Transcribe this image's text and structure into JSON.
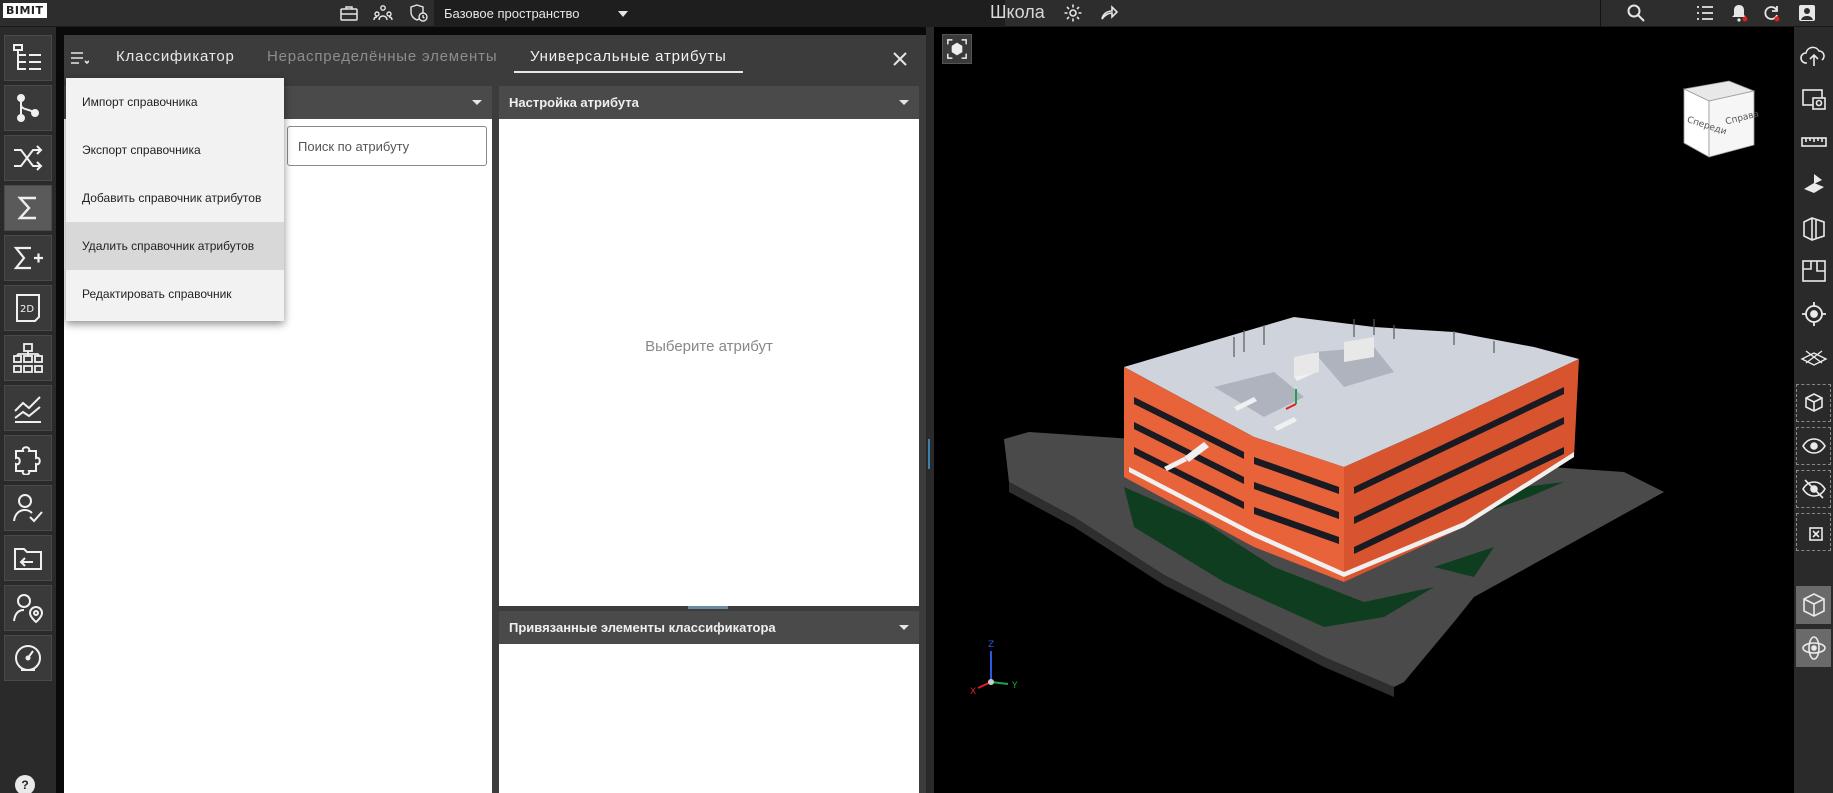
{
  "app": {
    "logo_text": "BIMIT",
    "space_label": "Базовое пространство",
    "project_title": "Школа"
  },
  "top_icons_left": [
    "briefcase-icon",
    "team-icon",
    "shield-clock-icon"
  ],
  "top_icons_center": [
    "gear-icon",
    "share-arrow-icon"
  ],
  "top_icons_right": [
    "search-icon",
    "list-icon",
    "bell-icon",
    "sync-icon",
    "user-icon"
  ],
  "left_toolbar": [
    {
      "name": "tree-structure-icon",
      "active": false
    },
    {
      "name": "branch-icon",
      "active": false
    },
    {
      "name": "shuffle-icon",
      "active": false
    },
    {
      "name": "sigma-icon",
      "active": true
    },
    {
      "name": "sigma-plus-icon",
      "active": false
    },
    {
      "name": "2d-sheet-icon",
      "active": false
    },
    {
      "name": "hierarchy-icon",
      "active": false
    },
    {
      "name": "chart-lines-icon",
      "active": false
    },
    {
      "name": "puzzle-icon",
      "active": false
    },
    {
      "name": "user-check-icon",
      "active": false
    },
    {
      "name": "folder-export-icon",
      "active": false
    },
    {
      "name": "user-location-icon",
      "active": false
    },
    {
      "name": "gauge-icon",
      "active": false
    }
  ],
  "help_label": "?",
  "panel": {
    "tabs": [
      {
        "label": "Классификатор"
      },
      {
        "label": "Нераспределённые элементы"
      },
      {
        "label": "Универсальные атрибуты"
      }
    ],
    "search_placeholder": "Поиск по атрибуту",
    "attr_settings_title": "Настройка атрибута",
    "attr_placeholder": "Выберите атрибут",
    "linked_title": "Привязанные элементы классификатора"
  },
  "dropdown": {
    "items": [
      {
        "label": "Импорт справочника"
      },
      {
        "label": "Экспорт справочника"
      },
      {
        "label": "Добавить справочник атрибутов"
      },
      {
        "label": "Удалить справочник атрибутов"
      },
      {
        "label": "Редактировать справочник"
      }
    ]
  },
  "viewcube": {
    "front": "Спереди",
    "right": "Справа"
  },
  "axes": {
    "x": "X",
    "y": "Y",
    "z": "Z"
  },
  "right_toolbar": [
    "cloud-upload-icon",
    "screenshot-icon",
    "ruler-icon",
    "section-plane-icon",
    "section-box-icon",
    "floor-plan-icon",
    "target-icon",
    "clip-plane-icon",
    "isolate-cube-icon",
    "show-eye-icon",
    "hide-eye-icon",
    "close-selection-icon",
    "cube-view-icon",
    "orbit-icon"
  ],
  "colors": {
    "facade": "#e8623a",
    "roof": "#cfd3db",
    "accent": "#3d7fa8"
  }
}
